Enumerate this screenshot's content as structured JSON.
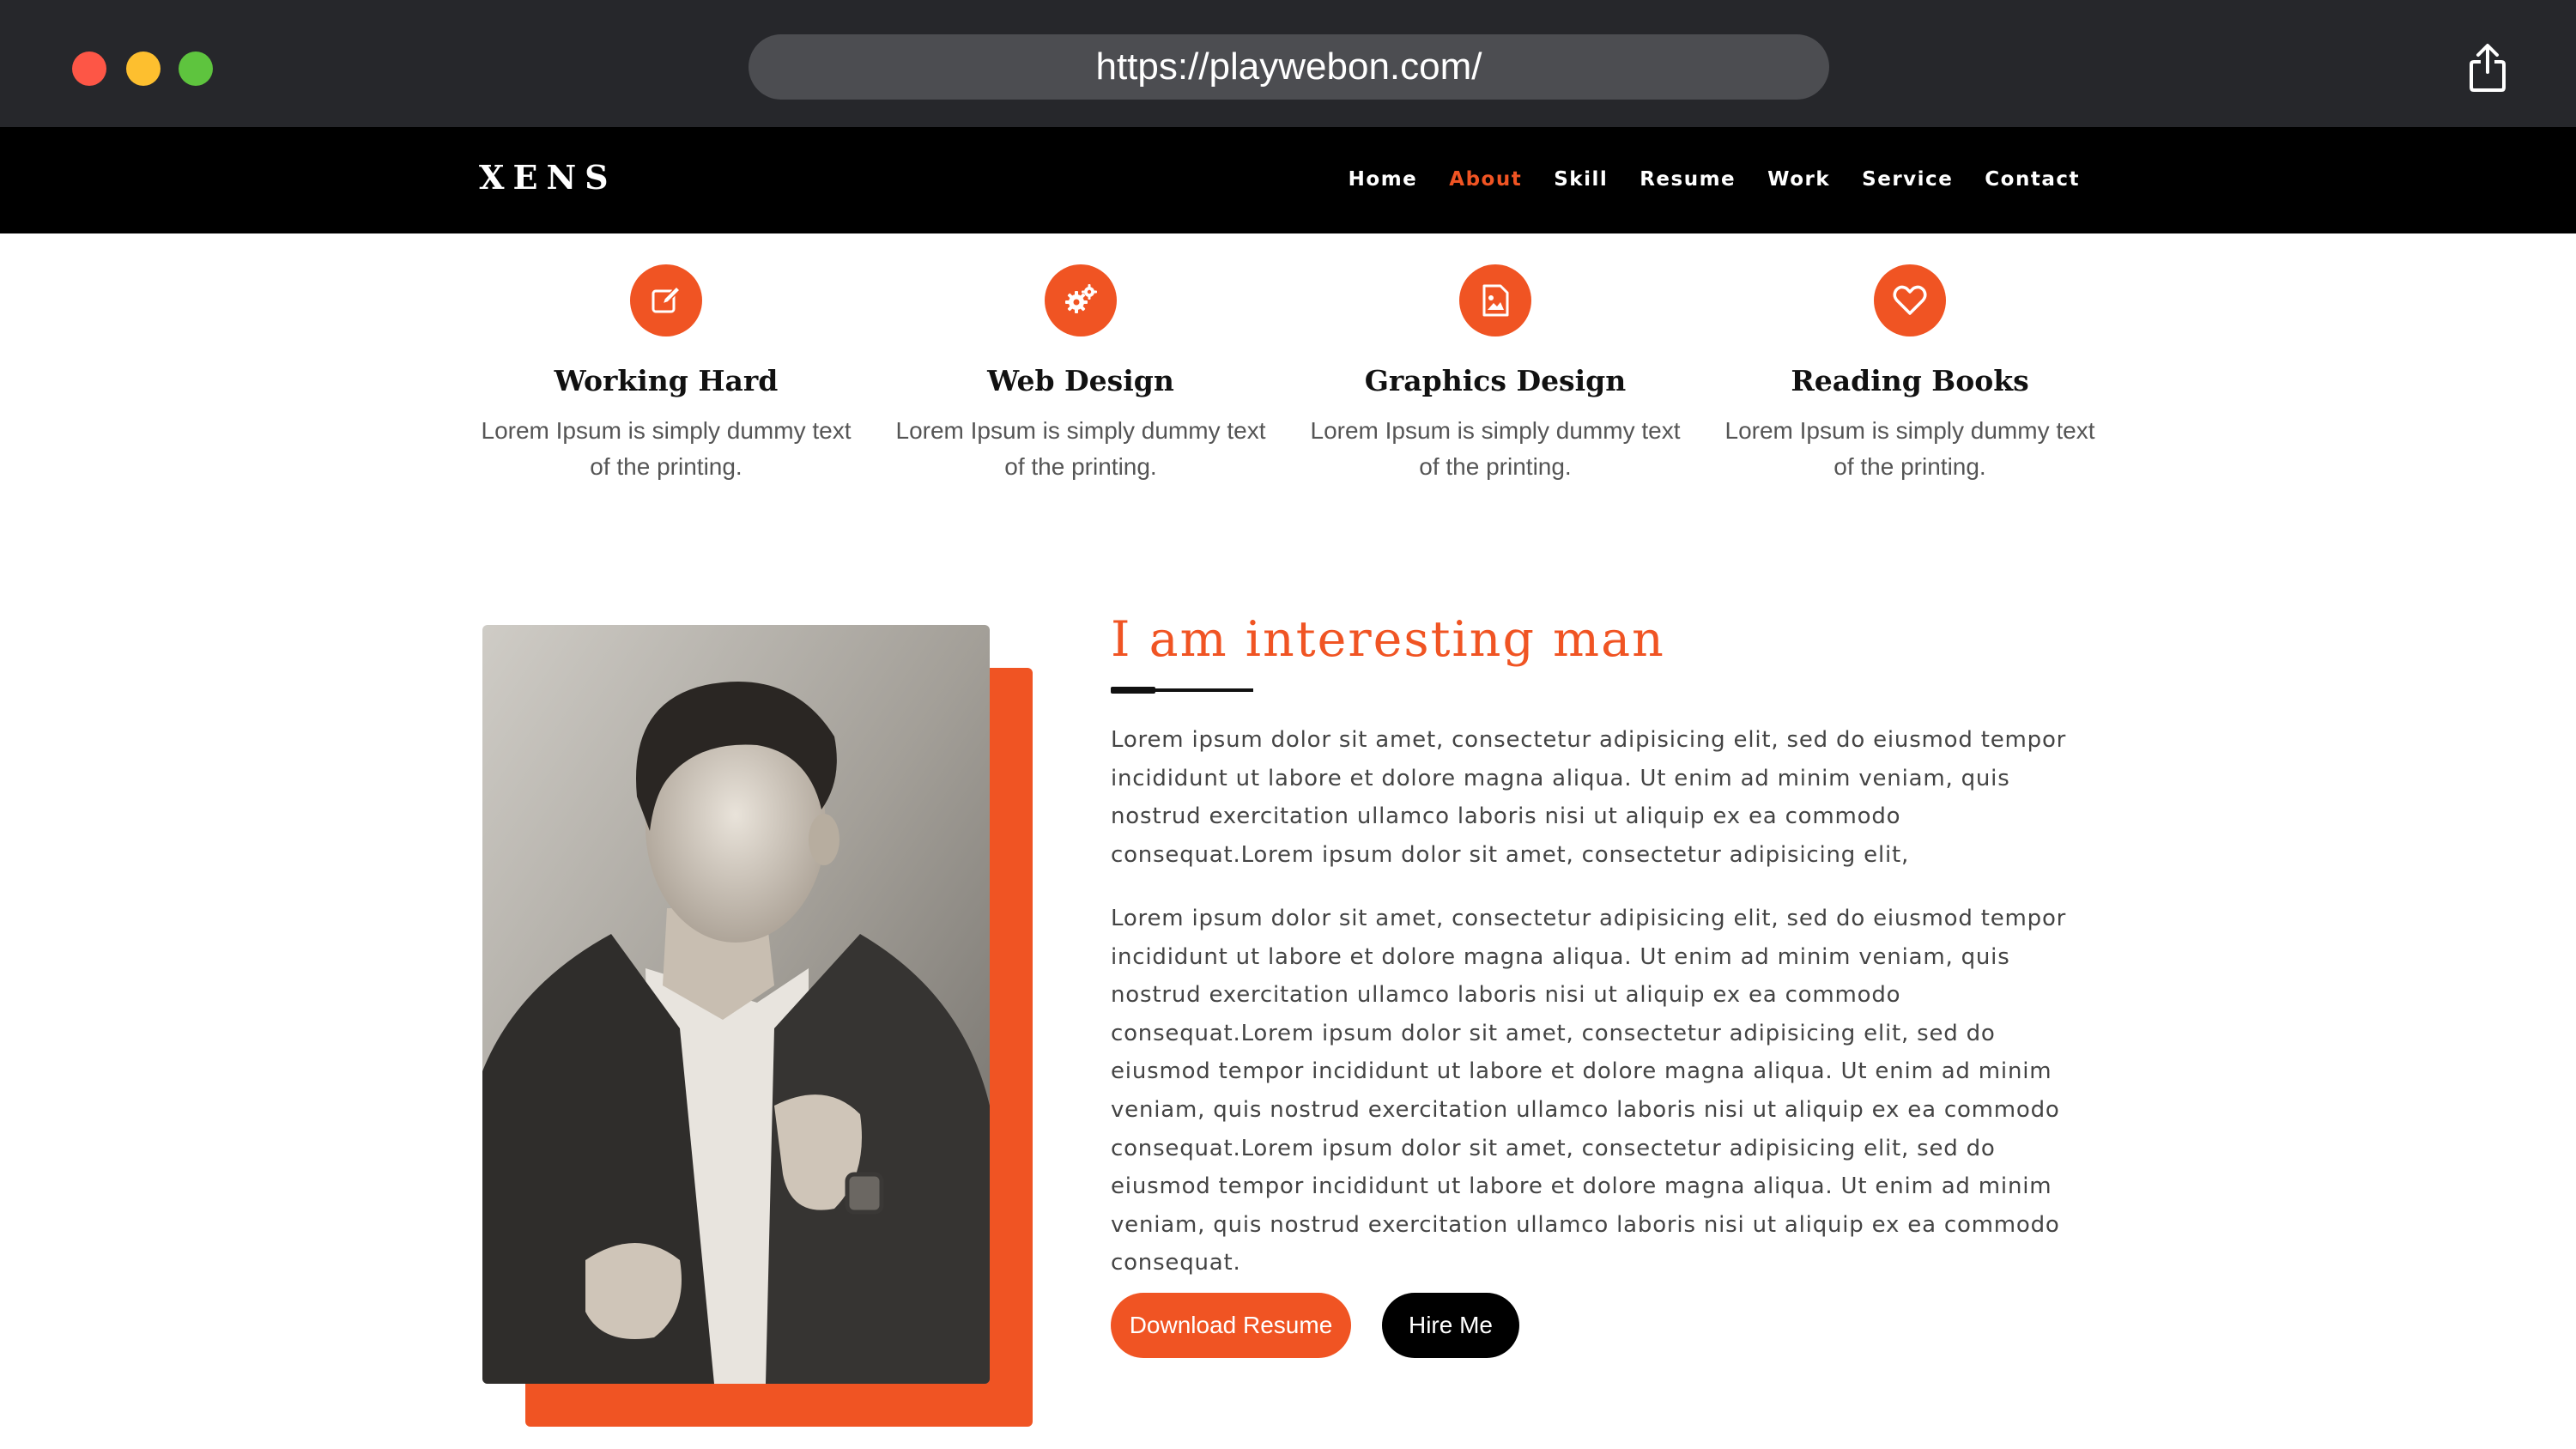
{
  "browser": {
    "url": "https://playwebon.com/",
    "share_icon": "share-icon"
  },
  "nav": {
    "logo": "XENS",
    "items": [
      {
        "label": "Home"
      },
      {
        "label": "About"
      },
      {
        "label": "Skill"
      },
      {
        "label": "Resume"
      },
      {
        "label": "Work"
      },
      {
        "label": "Service"
      },
      {
        "label": "Contact"
      }
    ],
    "active": "About"
  },
  "features": [
    {
      "icon": "edit-icon",
      "title": "Working Hard",
      "text": "Lorem Ipsum is simply dummy text of the printing."
    },
    {
      "icon": "gears-icon",
      "title": "Web Design",
      "text": "Lorem Ipsum is simply dummy text of the printing."
    },
    {
      "icon": "image-file-icon",
      "title": "Graphics Design",
      "text": "Lorem Ipsum is simply dummy text of the printing."
    },
    {
      "icon": "heart-icon",
      "title": "Reading Books",
      "text": "Lorem Ipsum is simply dummy text of the printing."
    }
  ],
  "about": {
    "title": "I am interesting man",
    "paragraph1": "Lorem ipsum dolor sit amet, consectetur adipisicing elit, sed do eiusmod tempor incididunt ut labore et dolore magna aliqua. Ut enim ad minim veniam, quis nostrud exercitation ullamco laboris nisi ut aliquip ex ea commodo consequat.Lorem ipsum dolor sit amet, consectetur adipisicing elit,",
    "paragraph2": "Lorem ipsum dolor sit amet, consectetur adipisicing elit, sed do eiusmod tempor incididunt ut labore et dolore magna aliqua. Ut enim ad minim veniam, quis nostrud exercitation ullamco laboris nisi ut aliquip ex ea commodo consequat.Lorem ipsum dolor sit amet, consectetur adipisicing elit, sed do eiusmod tempor incididunt ut labore et dolore magna aliqua. Ut enim ad minim veniam, quis nostrud exercitation ullamco laboris nisi ut aliquip ex ea commodo consequat.Lorem ipsum dolor sit amet, consectetur adipisicing elit, sed do eiusmod tempor incididunt ut labore et dolore magna aliqua. Ut enim ad minim veniam, quis nostrud exercitation ullamco laboris nisi ut aliquip ex ea commodo consequat.",
    "download_label": "Download Resume",
    "hire_label": "Hire Me"
  },
  "colors": {
    "accent": "#f05423",
    "chrome": "#26272b",
    "navbar": "#000000"
  }
}
